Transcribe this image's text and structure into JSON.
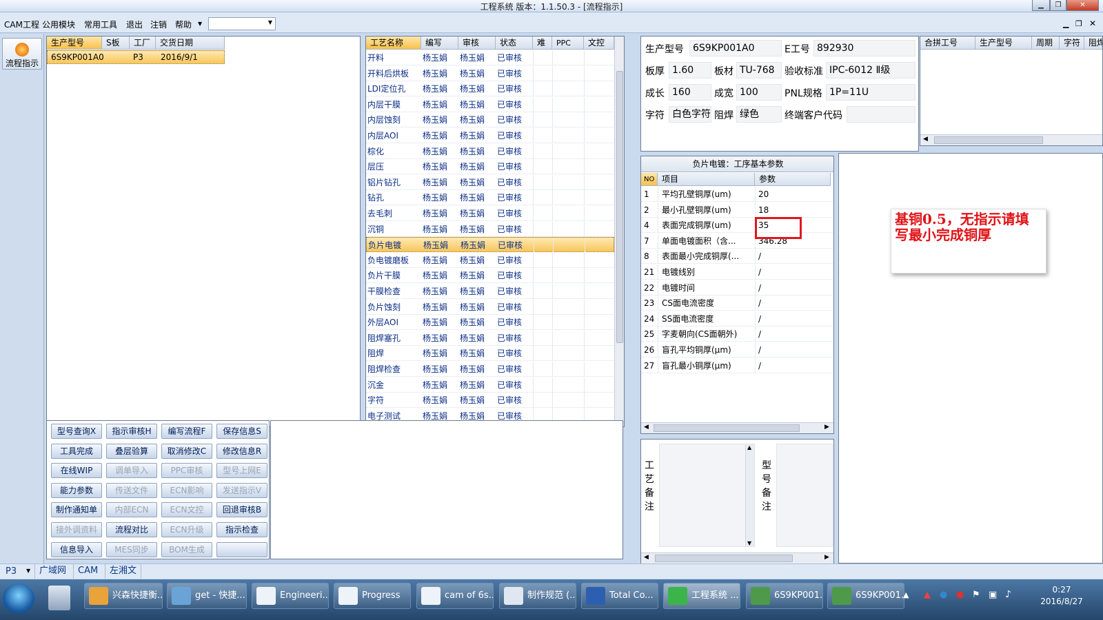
{
  "window": {
    "title": "工程系统  版本：1.1.50.3 - [流程指示]"
  },
  "menu": [
    "CAM工程",
    "公用模块",
    "常用工具",
    "退出",
    "注销",
    "帮助"
  ],
  "left": {
    "flow_button": "流程指示"
  },
  "orders": {
    "headers": [
      "生产型号",
      "S板",
      "工厂",
      "交货日期"
    ],
    "rows": [
      [
        "6S9KP001A0",
        "",
        "P3",
        "2016/9/1"
      ]
    ]
  },
  "process": {
    "headers": [
      "工艺名称",
      "编写",
      "审核",
      "状态",
      "难",
      "PPC",
      "文控"
    ],
    "rows": [
      [
        "开料",
        "杨玉娟",
        "杨玉娟",
        "已审核"
      ],
      [
        "开料后烘板",
        "杨玉娟",
        "杨玉娟",
        "已审核"
      ],
      [
        "LDI定位孔",
        "杨玉娟",
        "杨玉娟",
        "已审核"
      ],
      [
        "内层干膜",
        "杨玉娟",
        "杨玉娟",
        "已审核"
      ],
      [
        "内层蚀刻",
        "杨玉娟",
        "杨玉娟",
        "已审核"
      ],
      [
        "内层AOI",
        "杨玉娟",
        "杨玉娟",
        "已审核"
      ],
      [
        "棕化",
        "杨玉娟",
        "杨玉娟",
        "已审核"
      ],
      [
        "层压",
        "杨玉娟",
        "杨玉娟",
        "已审核"
      ],
      [
        "铝片钻孔",
        "杨玉娟",
        "杨玉娟",
        "已审核"
      ],
      [
        "钻孔",
        "杨玉娟",
        "杨玉娟",
        "已审核"
      ],
      [
        "去毛刺",
        "杨玉娟",
        "杨玉娟",
        "已审核"
      ],
      [
        "沉铜",
        "杨玉娟",
        "杨玉娟",
        "已审核"
      ],
      [
        "负片电镀",
        "杨玉娟",
        "杨玉娟",
        "已审核"
      ],
      [
        "负电镀磨板",
        "杨玉娟",
        "杨玉娟",
        "已审核"
      ],
      [
        "负片干膜",
        "杨玉娟",
        "杨玉娟",
        "已审核"
      ],
      [
        "干膜检查",
        "杨玉娟",
        "杨玉娟",
        "已审核"
      ],
      [
        "负片蚀刻",
        "杨玉娟",
        "杨玉娟",
        "已审核"
      ],
      [
        "外层AOI",
        "杨玉娟",
        "杨玉娟",
        "已审核"
      ],
      [
        "阻焊塞孔",
        "杨玉娟",
        "杨玉娟",
        "已审核"
      ],
      [
        "阻焊",
        "杨玉娟",
        "杨玉娟",
        "已审核"
      ],
      [
        "阻焊检查",
        "杨玉娟",
        "杨玉娟",
        "已审核"
      ],
      [
        "沉金",
        "杨玉娟",
        "杨玉娟",
        "已审核"
      ],
      [
        "字符",
        "杨玉娟",
        "杨玉娟",
        "已审核"
      ],
      [
        "电子测试",
        "杨玉娟",
        "杨玉娟",
        "已审核"
      ]
    ],
    "selected_index": 12
  },
  "buttons": [
    [
      "型号查询X",
      "指示审核H",
      "编写流程F",
      "保存信息S"
    ],
    [
      "工具完成",
      "叠层验算",
      "取消修改C",
      "修改信息R"
    ],
    [
      "在线WIP",
      "调单导入",
      "PPC审核",
      "型号上网E"
    ],
    [
      "能力参数",
      "传送文件",
      "ECN影响",
      "发送指示V"
    ],
    [
      "制作通知单",
      "内部ECN",
      "ECN文控",
      "回退审核B"
    ],
    [
      "接外调资料",
      "流程对比",
      "ECN升级",
      "指示检查"
    ],
    [
      "信息导入",
      "MES同步",
      "BOM生成",
      ""
    ]
  ],
  "disabled_buttons": [
    "调单导入",
    "PPC审核",
    "型号上网E",
    "传送文件",
    "ECN影响",
    "发送指示V",
    "内部ECN",
    "ECN文控",
    "接外调资料",
    "ECN升级",
    "MES同步",
    "BOM生成"
  ],
  "info": {
    "labels": {
      "model": "生产型号",
      "e_no": "E工号",
      "thickness": "板厚",
      "material": "板材",
      "standard": "验收标准",
      "length": "成长",
      "width": "成宽",
      "pnl": "PNL规格",
      "char": "字符",
      "mask": "阻焊",
      "customer": "终端客户代码"
    },
    "values": {
      "model": "6S9KP001A0",
      "e_no": "892930",
      "thickness": "1.60",
      "material": "TU-768",
      "standard": "IPC-6012 Ⅱ级",
      "length": "160",
      "width": "100",
      "pnl": "1P=11U",
      "char": "白色字符",
      "mask": "绿色",
      "customer": ""
    }
  },
  "combine": {
    "headers": [
      "合拼工号",
      "生产型号",
      "周期",
      "字符",
      "阻焊"
    ]
  },
  "params": {
    "title": "负片电镀：工序基本参数",
    "headers": [
      "NO",
      "项目",
      "参数"
    ],
    "rows": [
      [
        "1",
        "平均孔壁铜厚(um)",
        "20"
      ],
      [
        "2",
        "最小孔壁铜厚(um)",
        "18"
      ],
      [
        "4",
        "表面完成铜厚(um)",
        "35"
      ],
      [
        "7",
        "单面电镀面积（含...",
        "346.28"
      ],
      [
        "8",
        "表面最小完成铜厚(...",
        "/"
      ],
      [
        "21",
        "电镀线别",
        "/"
      ],
      [
        "22",
        "电镀时间",
        "/"
      ],
      [
        "23",
        "CS面电流密度",
        "/"
      ],
      [
        "24",
        "SS面电流密度",
        "/"
      ],
      [
        "25",
        "字麦朝向(CS面朝外)",
        "/"
      ],
      [
        "26",
        "盲孔平均铜厚(μm)",
        "/"
      ],
      [
        "27",
        "盲孔最小铜厚(μm)",
        "/"
      ]
    ]
  },
  "remarks": {
    "process_label": "工艺备注",
    "model_label": "型号备注"
  },
  "annotation": {
    "text": "基铜0.5，无指示请填写最小完成铜厚"
  },
  "status": {
    "site": "P3",
    "tags": [
      "广域网",
      "CAM",
      "左湘文"
    ]
  },
  "taskbar": {
    "items": [
      "兴森快捷衡...",
      "get - 快捷...",
      "Engineeri...",
      "Progress",
      "cam of 6s...",
      "制作规范 (...",
      "Total Co...",
      "工程系统 ...",
      "6S9KP001...",
      "6S9KP001..."
    ],
    "time": "0:27",
    "date": "2016/8/27"
  }
}
